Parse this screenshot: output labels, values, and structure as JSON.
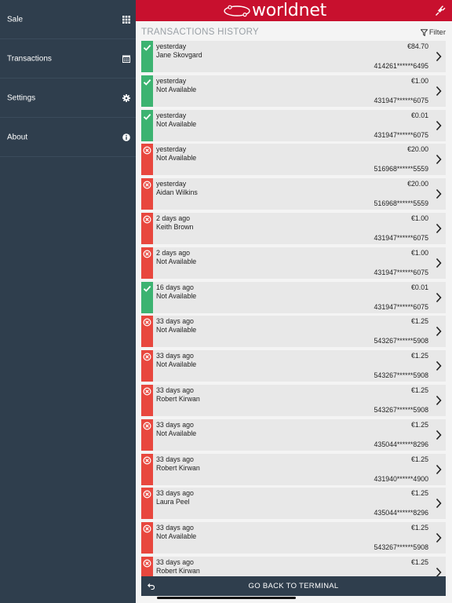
{
  "sidebar": {
    "items": [
      {
        "label": "Sale",
        "icon": "grid-icon"
      },
      {
        "label": "Transactions",
        "icon": "calendar-icon"
      },
      {
        "label": "Settings",
        "icon": "gear-icon"
      },
      {
        "label": "About",
        "icon": "info-icon"
      }
    ]
  },
  "header": {
    "logo_text": "worldnet",
    "brand_color": "#c8102e",
    "right_icon": "plug-icon"
  },
  "main": {
    "title": "TRANSACTIONS HISTORY",
    "filter_label": "Filter",
    "transactions": [
      {
        "status": "success",
        "when": "yesterday",
        "name": "Jane Skovgard",
        "amount": "€84.70",
        "card": "414261******6495"
      },
      {
        "status": "success",
        "when": "yesterday",
        "name": "Not Available",
        "amount": "€1.00",
        "card": "431947******6075"
      },
      {
        "status": "success",
        "when": "yesterday",
        "name": "Not Available",
        "amount": "€0.01",
        "card": "431947******6075"
      },
      {
        "status": "failed",
        "when": "yesterday",
        "name": "Not Available",
        "amount": "€20.00",
        "card": "516968******5559"
      },
      {
        "status": "failed",
        "when": "yesterday",
        "name": "Aidan Wilkins",
        "amount": "€20.00",
        "card": "516968******5559"
      },
      {
        "status": "failed",
        "when": "2 days ago",
        "name": "Keith Brown",
        "amount": "€1.00",
        "card": "431947******6075"
      },
      {
        "status": "failed",
        "when": "2 days ago",
        "name": "Not Available",
        "amount": "€1.00",
        "card": "431947******6075"
      },
      {
        "status": "success",
        "when": "16 days ago",
        "name": "Not Available",
        "amount": "€0.01",
        "card": "431947******6075"
      },
      {
        "status": "failed",
        "when": "33 days ago",
        "name": "Not Available",
        "amount": "€1.25",
        "card": "543267******5908"
      },
      {
        "status": "failed",
        "when": "33 days ago",
        "name": "Not Available",
        "amount": "€1.25",
        "card": "543267******5908"
      },
      {
        "status": "failed",
        "when": "33 days ago",
        "name": "Robert Kirwan",
        "amount": "€1.25",
        "card": "543267******5908"
      },
      {
        "status": "failed",
        "when": "33 days ago",
        "name": "Not Available",
        "amount": "€1.25",
        "card": "435044******8296"
      },
      {
        "status": "failed",
        "when": "33 days ago",
        "name": "Robert Kirwan",
        "amount": "€1.25",
        "card": "431940******4900"
      },
      {
        "status": "failed",
        "when": "33 days ago",
        "name": "Laura Peel",
        "amount": "€1.25",
        "card": "435044******8296"
      },
      {
        "status": "failed",
        "when": "33 days ago",
        "name": "Not Available",
        "amount": "€1.25",
        "card": "543267******5908"
      },
      {
        "status": "failed",
        "when": "33 days ago",
        "name": "Robert Kirwan",
        "amount": "€1.25",
        "card": ""
      }
    ]
  },
  "footer": {
    "button_label": "GO BACK TO TERMINAL"
  },
  "colors": {
    "sidebar_bg": "#2f3e4d",
    "success": "#3cb371",
    "failed": "#e8473e",
    "row_bg": "#e8e8e8"
  }
}
